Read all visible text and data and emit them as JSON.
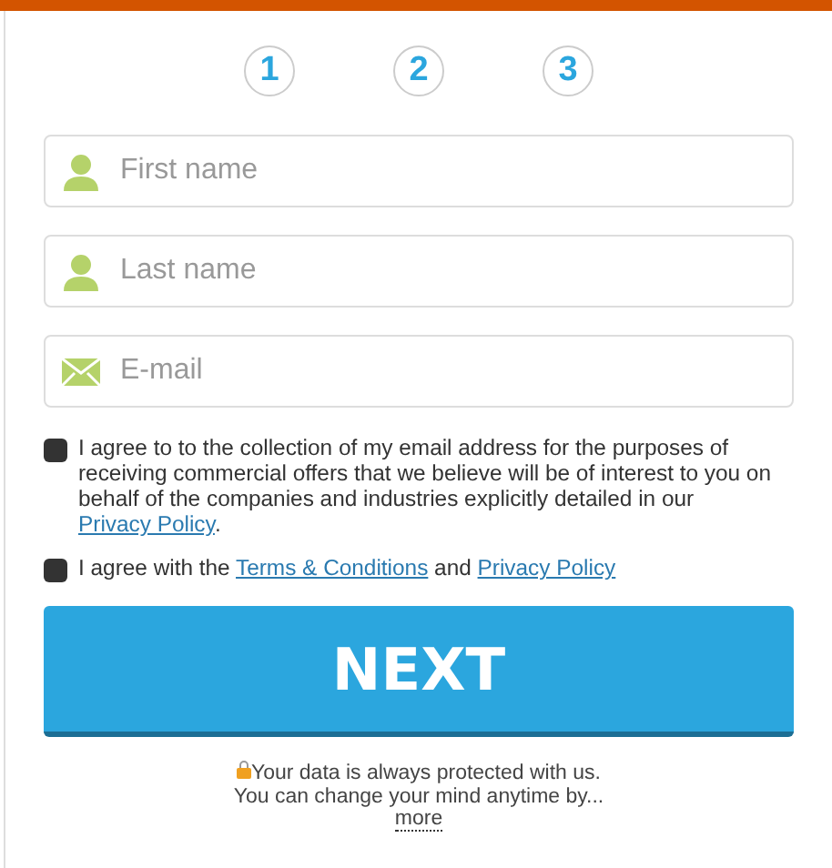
{
  "steps": [
    {
      "label": "1"
    },
    {
      "label": "2"
    },
    {
      "label": "3"
    }
  ],
  "fields": [
    {
      "kind": "person",
      "placeholder": "First name"
    },
    {
      "kind": "person",
      "placeholder": "Last name"
    },
    {
      "kind": "mail",
      "placeholder": "E-mail"
    }
  ],
  "consents": [
    {
      "checked": false,
      "parts": [
        {
          "kind": "text",
          "text": "I agree to to the collection of my email address for the purposes of receiving commercial offers that we believe will be of interest to you on behalf of the companies and industries explicitly detailed in our "
        },
        {
          "kind": "link",
          "text": "Privacy Policy"
        },
        {
          "kind": "text",
          "text": "."
        }
      ]
    },
    {
      "checked": false,
      "parts": [
        {
          "kind": "text",
          "text": "I agree with the "
        },
        {
          "kind": "link",
          "text": "Terms & Conditions"
        },
        {
          "kind": "text",
          "text": " and "
        },
        {
          "kind": "link",
          "text": "Privacy Policy"
        }
      ]
    }
  ],
  "next_button": "NEXT",
  "privacy_note": {
    "line1": "Your data is always protected with us.",
    "line2": "You can change your mind anytime by...",
    "more": "more"
  }
}
